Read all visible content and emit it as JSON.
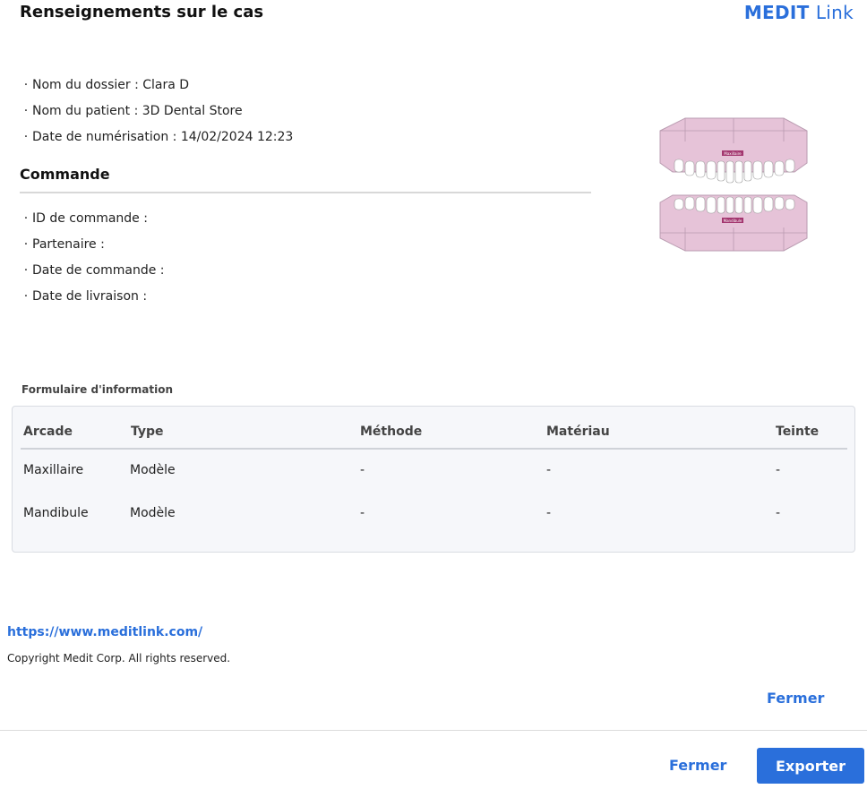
{
  "header": {
    "title": "Renseignements sur le cas",
    "logo_brand": "MEDIT",
    "logo_link": "Link",
    "brand_color": "#2a6fdb"
  },
  "case_info": [
    {
      "label": "Nom du dossier : Clara D"
    },
    {
      "label": "Nom du patient : 3D Dental Store"
    },
    {
      "label": "Date de numérisation : 14/02/2024 12:23"
    }
  ],
  "order": {
    "title": "Commande",
    "items": [
      {
        "label": "ID de commande :"
      },
      {
        "label": "Partenaire :"
      },
      {
        "label": "Date de commande :"
      },
      {
        "label": "Date de livraison :"
      }
    ]
  },
  "teeth_image": {
    "upper_label": "Maxillaire",
    "lower_label": "Mandibule",
    "gum_color": "#e6c3d8",
    "label_color": "#a3366f"
  },
  "form": {
    "title": "Formulaire d'information",
    "headers": [
      "Arcade",
      "Type",
      "Méthode",
      "Matériau",
      "Teinte"
    ],
    "rows": [
      [
        "Maxillaire",
        "Modèle",
        "-",
        "-",
        "-"
      ],
      [
        "Mandibule",
        "Modèle",
        "-",
        "-",
        "-"
      ]
    ]
  },
  "footer": {
    "url": "https://www.meditlink.com/",
    "copyright": "Copyright Medit Corp. All rights reserved.",
    "close_top": "Fermer",
    "close_bottom": "Fermer",
    "export": "Exporter"
  }
}
